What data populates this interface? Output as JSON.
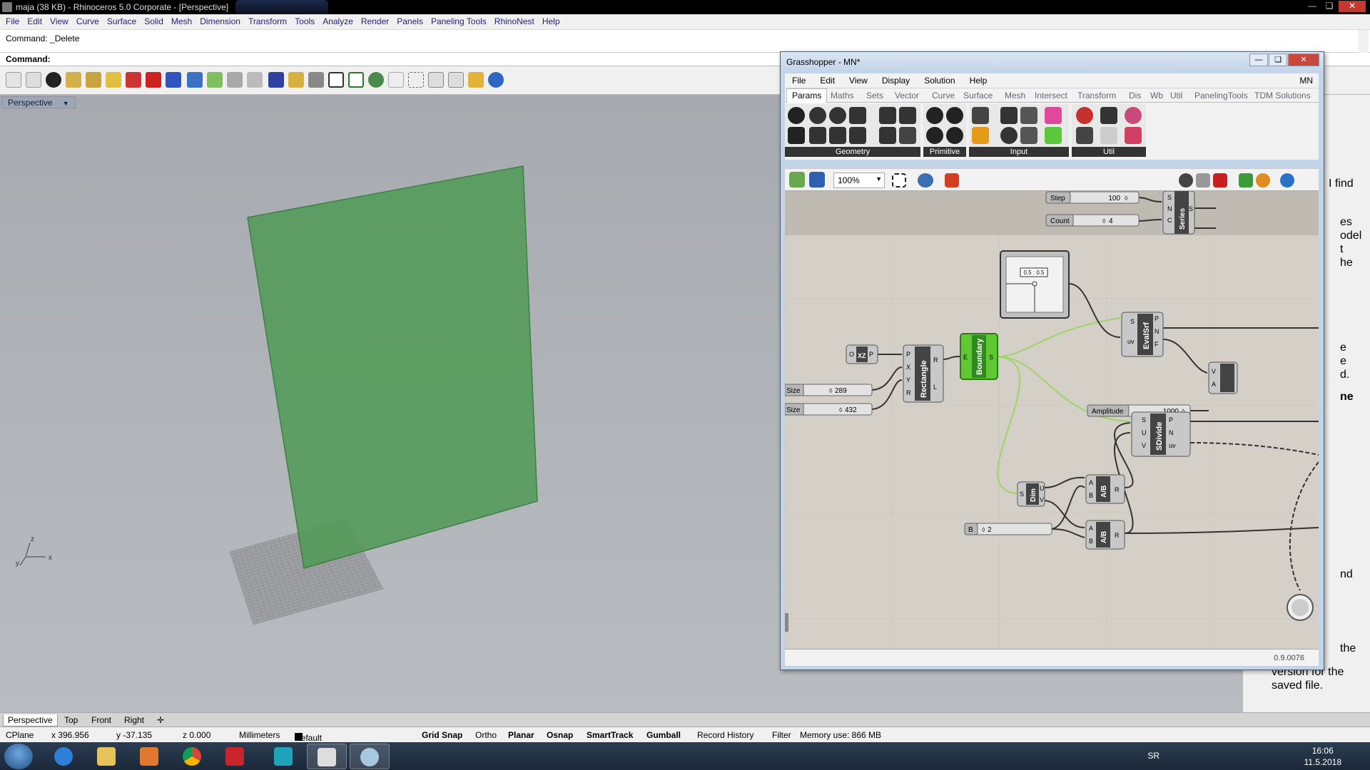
{
  "rhino": {
    "title": "maja (38 KB) - Rhinoceros  5.0 Corporate - [Perspective]",
    "menu": [
      "File",
      "Edit",
      "View",
      "Curve",
      "Surface",
      "Solid",
      "Mesh",
      "Dimension",
      "Transform",
      "Tools",
      "Analyze",
      "Render",
      "Panels",
      "Paneling Tools",
      "RhinoNest",
      "Help"
    ],
    "command_history": "Command: _Delete",
    "command_prompt": "Command:",
    "viewport_label": "Perspective",
    "axis_x": "x",
    "axis_y": "y",
    "axis_z": "z",
    "viewport_tabs": [
      "Perspective",
      "Top",
      "Front",
      "Right"
    ],
    "status": {
      "cplane": "CPlane",
      "x": "x 396.956",
      "y": "y -37.135",
      "z": "z 0.000",
      "units": "Millimeters",
      "layer": "Default",
      "grid_snap": "Grid Snap",
      "ortho": "Ortho",
      "planar": "Planar",
      "osnap": "Osnap",
      "smarttrack": "SmartTrack",
      "gumball": "Gumball",
      "record_history": "Record History",
      "filter": "Filter",
      "memory": "Memory use: 866 MB"
    },
    "side_panel_text": "version for the saved file.",
    "side_panel_partial": [
      "I find",
      "es",
      "odel",
      "t",
      "he",
      "e",
      "e",
      "d.",
      "ne",
      "nd",
      "the"
    ]
  },
  "grasshopper": {
    "title": "Grasshopper - MN*",
    "menu": [
      "File",
      "Edit",
      "View",
      "Display",
      "Solution",
      "Help"
    ],
    "menu_right": "MN",
    "tabs": [
      "Params",
      "Maths",
      "Sets",
      "Vector",
      "Curve",
      "Surface",
      "Mesh",
      "Intersect",
      "Transform",
      "Dis",
      "Wb",
      "Util",
      "PanelingTools",
      "TDM Solutions"
    ],
    "ribbon_groups": [
      "Geometry",
      "Primitive",
      "Input",
      "Util"
    ],
    "zoom": "100%",
    "version": "0.9.0076",
    "nodes": {
      "step_label": "Step",
      "step_value": "100",
      "count_label": "Count",
      "count_value": "4",
      "series_label": "Series",
      "series_in": [
        "S",
        "N",
        "C"
      ],
      "series_out": [
        "S"
      ],
      "xz_label": "XZ",
      "xz_in": [
        "O"
      ],
      "xz_out": [
        "P"
      ],
      "size1_label": "Size",
      "size1_value": "289",
      "size2_label": "Size",
      "size2_value": "432",
      "rect_label": "Rectangle",
      "rect_in": [
        "P",
        "X",
        "Y",
        "R"
      ],
      "rect_out": [
        "R",
        "L"
      ],
      "boundary_label": "Boundary",
      "boundary_in": [
        "E"
      ],
      "boundary_out": [
        "S"
      ],
      "mdslider_value": "0.5 : 0.5",
      "evalsrf_label": "EvalSrf",
      "evalsrf_in": [
        "S",
        "uv"
      ],
      "evalsrf_out": [
        "P",
        "N",
        "F"
      ],
      "amplitude_label": "Amplitude",
      "amplitude_value": "1000",
      "amp_partial_in": [
        "V",
        "A"
      ],
      "sdivide_label": "SDivide",
      "sdivide_in": [
        "S",
        "U",
        "V"
      ],
      "sdivide_out": [
        "P",
        "N",
        "uv"
      ],
      "dim_label": "Dim",
      "dim_in": [
        "S"
      ],
      "dim_out": [
        "U",
        "V"
      ],
      "div1_label": "A/B",
      "div1_in": [
        "A",
        "B"
      ],
      "div1_out": [
        "R"
      ],
      "div2_label": "A/B",
      "div2_in": [
        "A",
        "B"
      ],
      "div2_out": [
        "R"
      ],
      "b_label": "B",
      "b_value": "2"
    }
  },
  "taskbar": {
    "language": "SR",
    "time": "16:06",
    "date": "11.5.2018"
  },
  "colors": {
    "surface_green": "#4f9a55",
    "boundary_green": "#5fc832",
    "wire_green": "#9ed465",
    "canvas": "#d4d0c8"
  }
}
